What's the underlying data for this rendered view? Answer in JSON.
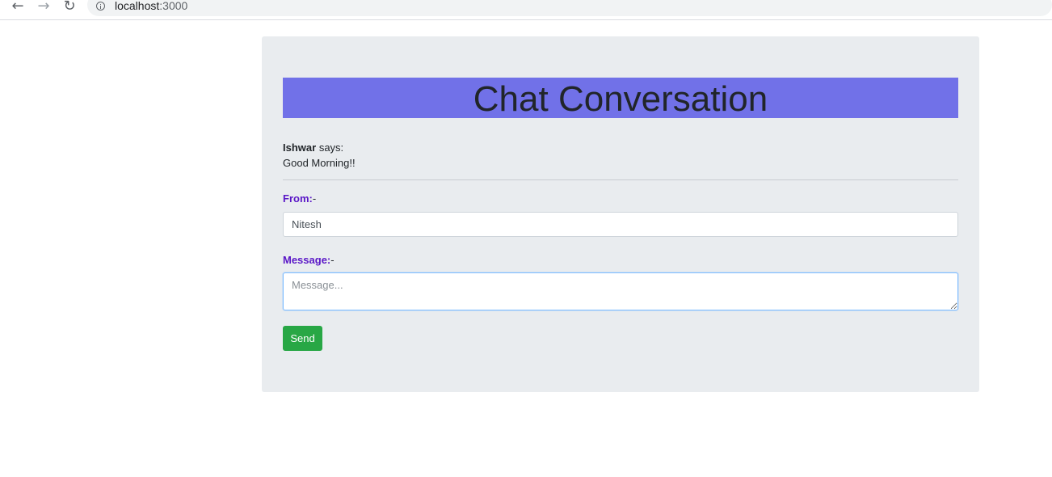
{
  "browser": {
    "back_icon": "arrow-left-icon",
    "forward_icon": "arrow-right-icon",
    "reload_icon": "reload-icon",
    "url_host": "localhost",
    "url_port": ":3000"
  },
  "chat": {
    "title": "Chat Conversation",
    "messages": [
      {
        "sender": "Ishwar",
        "says": "says:",
        "text": "Good Morning!!"
      }
    ]
  },
  "form": {
    "from_label": "From:",
    "from_suffix": "-",
    "from_value": "Nitesh",
    "message_label": "Message:",
    "message_suffix": "-",
    "message_placeholder": "Message...",
    "send_label": "Send"
  },
  "colors": {
    "header_bg": "#7171e8",
    "label_color": "#5a17c7",
    "send_bg": "#28a745",
    "card_bg": "#e9ecef"
  }
}
